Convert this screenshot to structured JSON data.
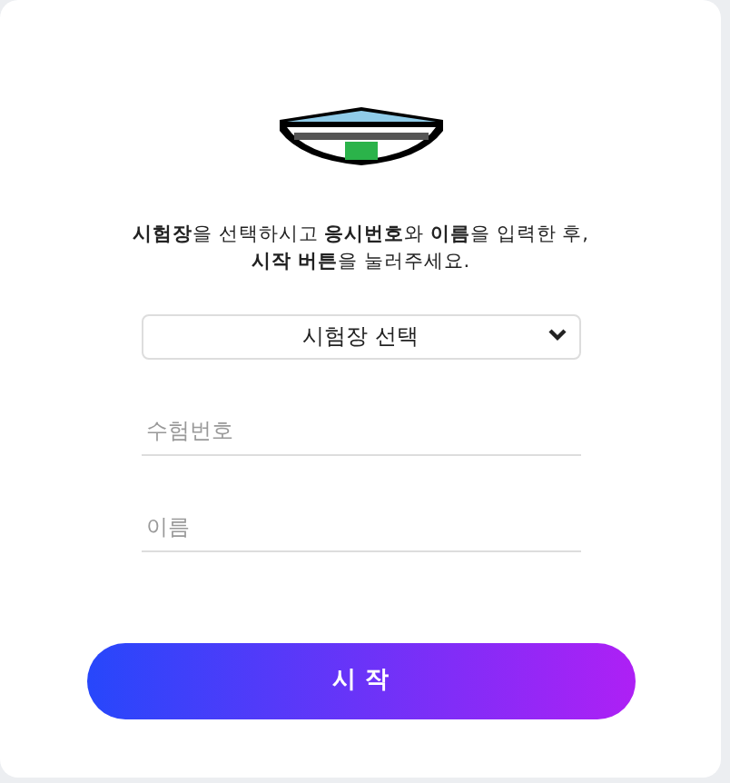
{
  "instructions": [
    "**시험장**을 선택하시고 **응시번호**와 **이름**을 입력한 후,",
    "**시작 버튼**을 눌러주세요."
  ],
  "venue_select": {
    "value": "시험장 선택"
  },
  "fields": [
    {
      "placeholder": "수험번호"
    },
    {
      "placeholder": "이름"
    }
  ],
  "start_button": "시 작"
}
